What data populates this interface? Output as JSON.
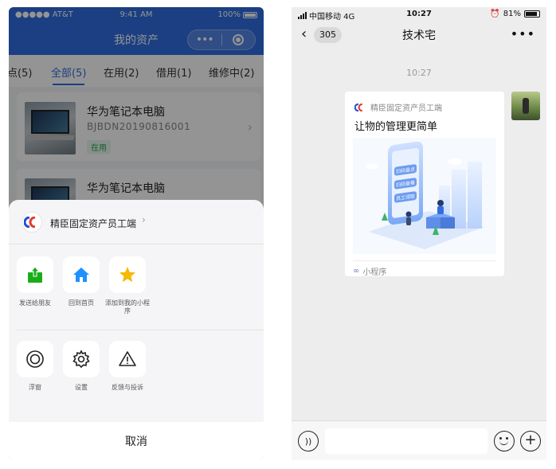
{
  "left": {
    "status": {
      "carrier": "●●●●● AT&T",
      "time": "9:41 AM",
      "battery": "100%"
    },
    "navbar": {
      "title": "我的资产"
    },
    "tabs": [
      {
        "label": "点(5)"
      },
      {
        "label": "全部(5)",
        "active": true
      },
      {
        "label": "在用(2)"
      },
      {
        "label": "借用(1)"
      },
      {
        "label": "维修中(2)"
      }
    ],
    "assets": [
      {
        "name": "华为笔记本电脑",
        "code": "BJBDN20190816001",
        "status": "在用"
      },
      {
        "name": "华为笔记本电脑"
      }
    ],
    "sheet": {
      "app_name": "精臣固定资产员工端",
      "row1": [
        {
          "label": "发送给朋友",
          "icon": "share-icon"
        },
        {
          "label": "回到首页",
          "icon": "home-icon"
        },
        {
          "label": "添加到我的小程序",
          "icon": "star-icon"
        }
      ],
      "row2": [
        {
          "label": "浮窗",
          "icon": "float-window-icon"
        },
        {
          "label": "设置",
          "icon": "gear-icon"
        },
        {
          "label": "反馈与投诉",
          "icon": "warning-icon"
        }
      ],
      "cancel": "取消"
    },
    "colors": {
      "brand": "#2f6de0",
      "share": "#1aad19",
      "home": "#1e90ff",
      "star": "#f5b900"
    }
  },
  "right": {
    "status": {
      "carrier": "中国移动 4G",
      "time": "10:27",
      "battery": "81%"
    },
    "nav": {
      "back_count": "305",
      "title": "技术宅"
    },
    "timestamp": "10:27",
    "card": {
      "source": "精臣固定资产员工端",
      "title": "让物的管理更简单",
      "art_labels": [
        "扫码盘点",
        "扫码查看",
        "员工领取"
      ],
      "footer": "小程序"
    }
  }
}
